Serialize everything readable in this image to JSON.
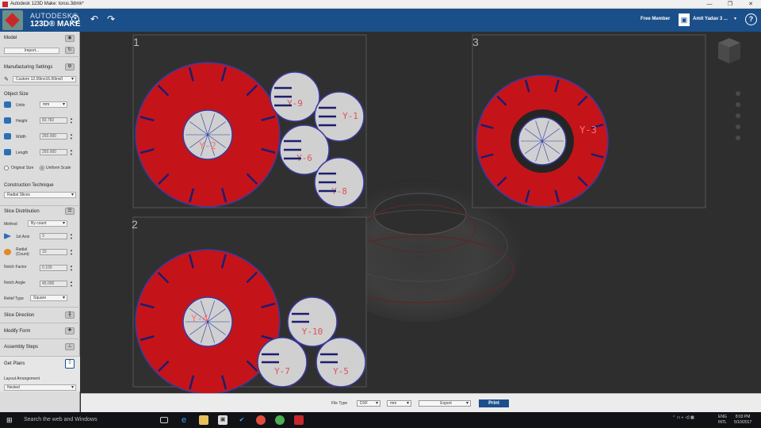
{
  "window": {
    "title": "Autodesk 123D Make: torus.3dmk*",
    "controls": [
      "—",
      "❐",
      "✕"
    ]
  },
  "appbar": {
    "brand_top": "AUTODESK®",
    "brand_bottom": "123D® MAKE",
    "menu_glyph": "▾",
    "undo_glyph": "↶",
    "redo_glyph": "↷",
    "membership": "Free Member",
    "user": "Amit Yadav 3 ...",
    "user_dropdown": "▾",
    "help": "?"
  },
  "sidebar": {
    "model": {
      "title": "Model",
      "import_label": "Import..."
    },
    "manufacturing": {
      "title": "Manufacturing Settings",
      "sheet": "Custom 12.00inx16.00inx0"
    },
    "object_size": {
      "title": "Object Size",
      "units_label": "Units",
      "units": "mm",
      "height_label": "Height",
      "height": "83.782",
      "width_label": "Width",
      "width": "250.000",
      "length_label": "Length",
      "length": "250.000",
      "original_label": "Original Size",
      "uniform_label": "Uniform Scale"
    },
    "construction": {
      "title": "Construction Technique",
      "technique": "Radial Slices"
    },
    "distribution": {
      "title": "Slice Distribution",
      "method_label": "Method",
      "method": "By count",
      "axis_label": "1st Axis",
      "axis": "3",
      "radial_label": "Radial\n(Count)",
      "radial": "10",
      "notch_factor_label": "Notch Factor",
      "notch_factor": "0.100",
      "notch_angle_label": "Notch Angle",
      "notch_angle": "45.000",
      "relief_label": "Relief Type",
      "relief": "Square"
    },
    "slice_direction": {
      "title": "Slice Direction"
    },
    "modify_form": {
      "title": "Modify Form"
    },
    "assembly": {
      "title": "Assembly Steps"
    },
    "plans": {
      "title": "Get Plans",
      "layout_label": "Layout Arrangement",
      "layout": "Nested"
    }
  },
  "sheets": [
    {
      "number": "1",
      "big_label": "Y-2",
      "inner_label": "Y-2",
      "small": [
        "Y-9",
        "Y-1",
        "Y-6",
        "Y-8"
      ]
    },
    {
      "number": "2",
      "big_label": "Y-4",
      "inner_label": "Y-4",
      "small": [
        "Y-10",
        "Y-7",
        "Y-5"
      ]
    },
    {
      "number": "3",
      "big_label": "Y-3",
      "inner_label": "Y-3",
      "small": []
    }
  ],
  "bottombar": {
    "file_type_label": "File Type",
    "file_type": "DXF",
    "unit": "mm",
    "export_label": "Export",
    "print_label": "Print"
  },
  "taskbar": {
    "search": "Search the web and Windows",
    "lang": "ENG",
    "intl": "INTL",
    "time": "8:03 PM",
    "date": "5/10/2017"
  },
  "colors": {
    "accent": "#1b4f8a",
    "slice_red": "#c4141a",
    "slice_outline": "#3a3aa0",
    "print_button": "#1c4f8c"
  }
}
